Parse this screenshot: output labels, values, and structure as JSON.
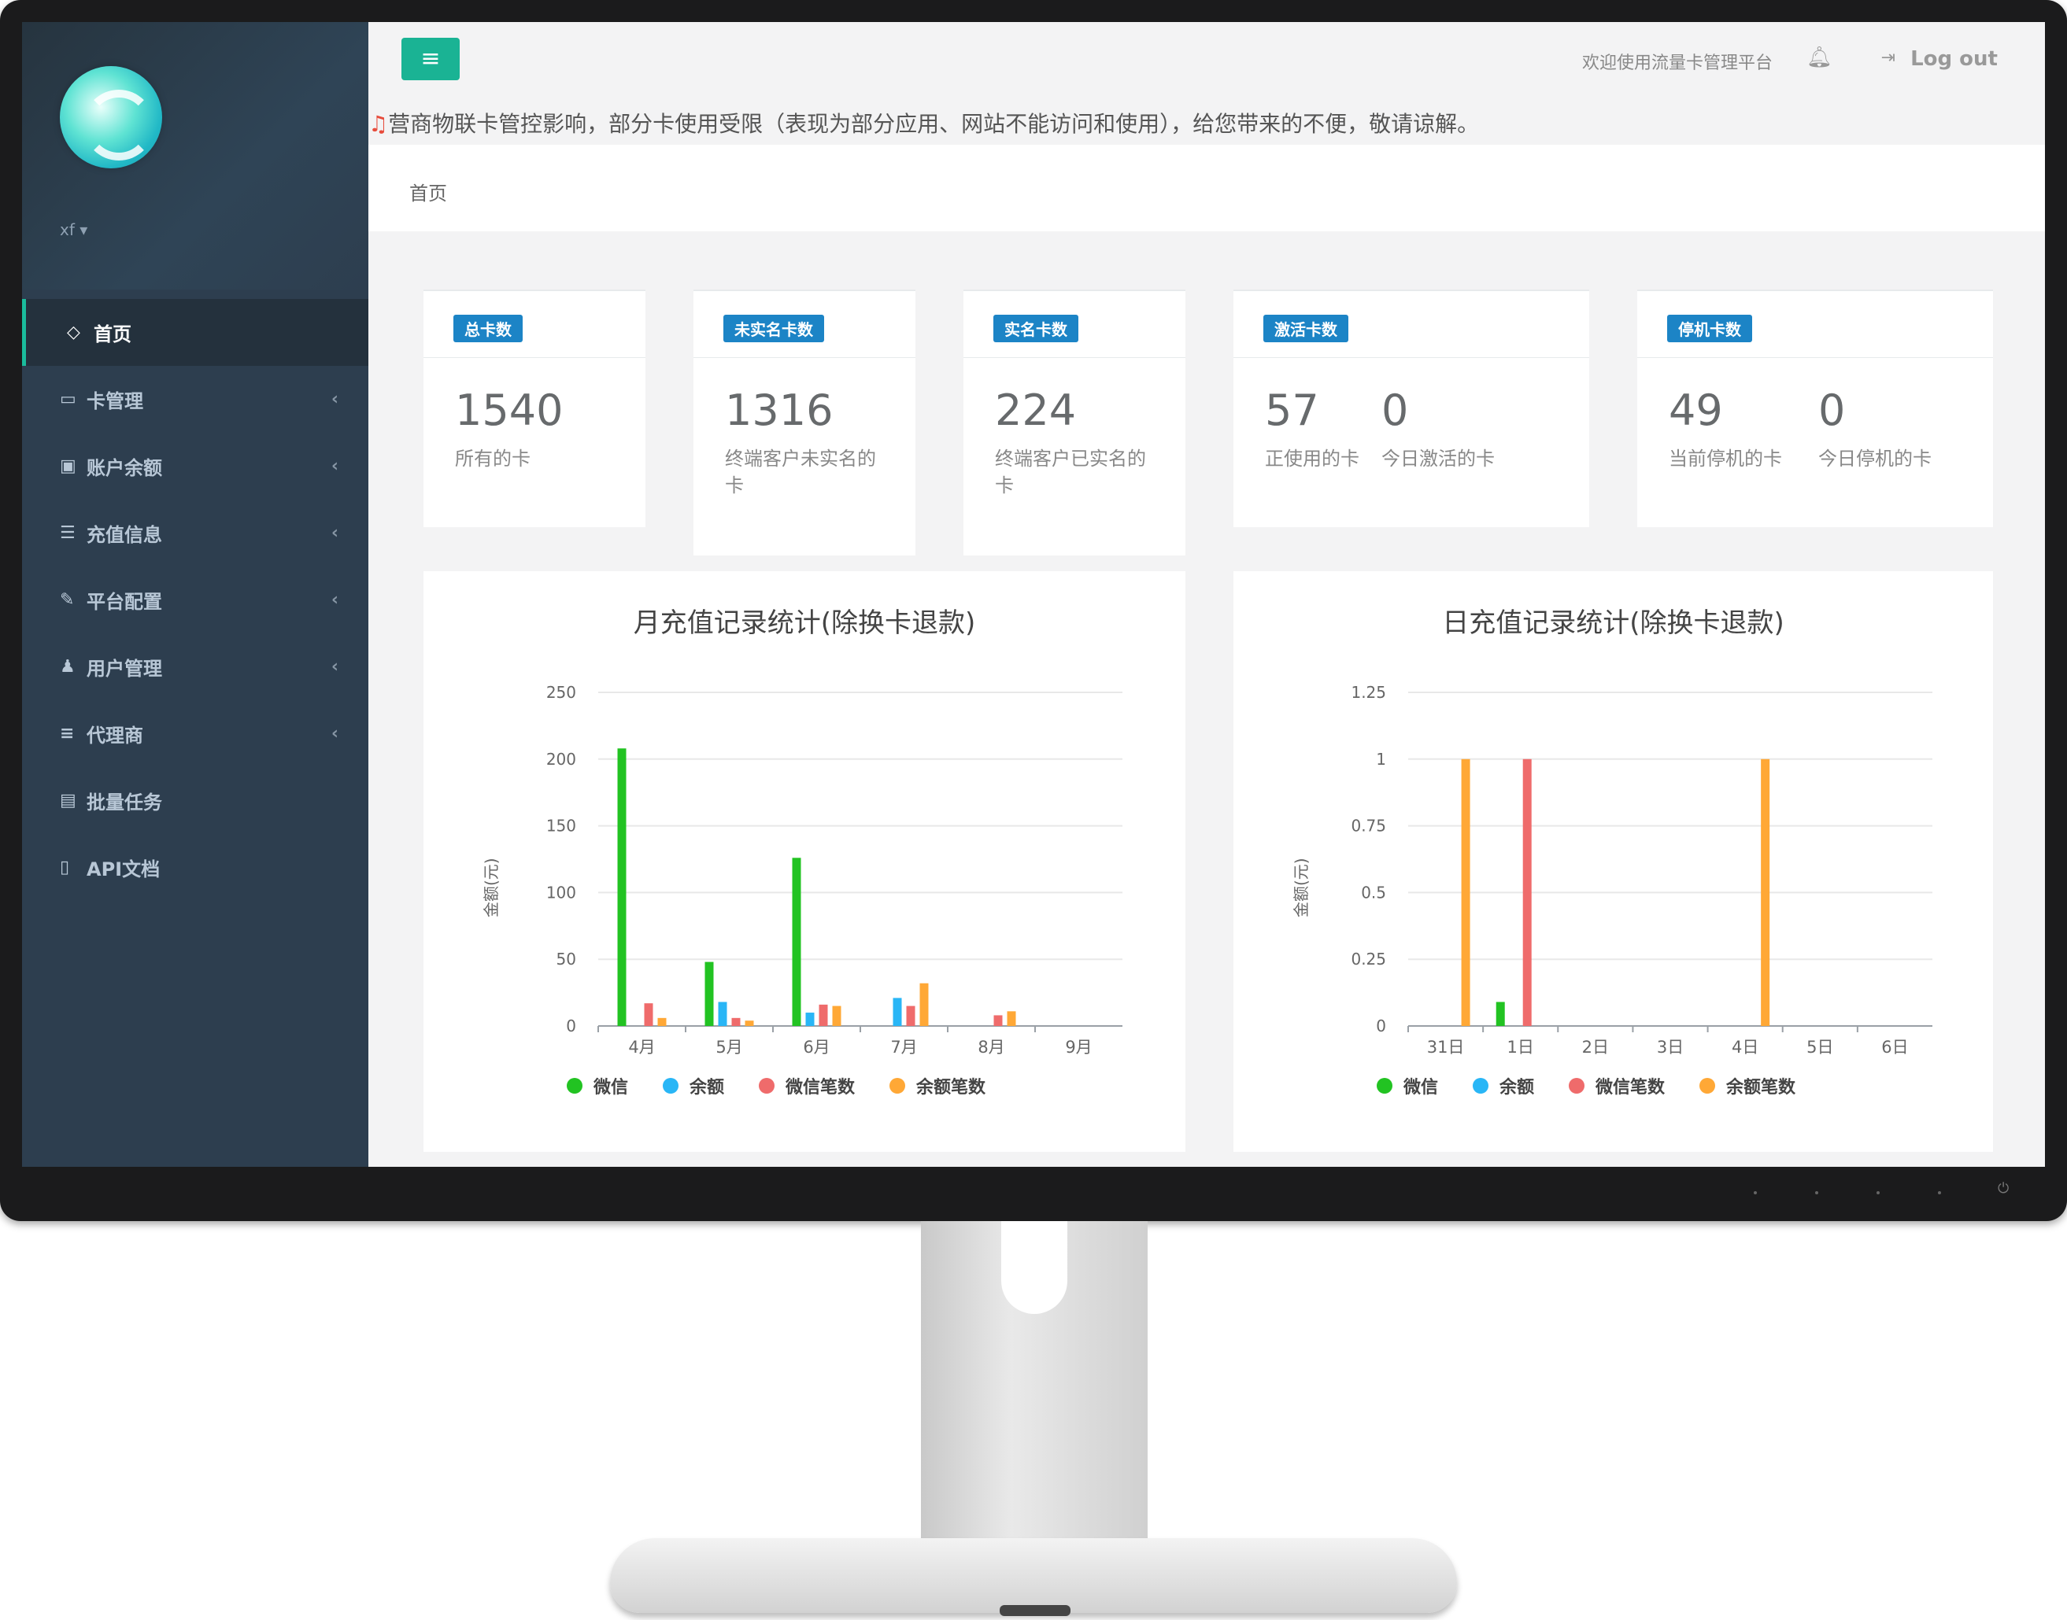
{
  "sidebar": {
    "user": "xf",
    "items": [
      {
        "label": "首页",
        "icon": "gem-icon"
      },
      {
        "label": "卡管理",
        "icon": "credit-card-icon"
      },
      {
        "label": "账户余额",
        "icon": "money-icon"
      },
      {
        "label": "充值信息",
        "icon": "list-icon"
      },
      {
        "label": "平台配置",
        "icon": "wrench-icon"
      },
      {
        "label": "用户管理",
        "icon": "users-icon"
      },
      {
        "label": "代理商",
        "icon": "bars-icon"
      },
      {
        "label": "批量任务",
        "icon": "tasks-icon"
      },
      {
        "label": "API文档",
        "icon": "file-icon"
      }
    ]
  },
  "header": {
    "welcome": "欢迎使用流量卡管理平台",
    "logout": "Log out",
    "notice": "营商物联卡管控影响，部分卡使用受限（表现为部分应用、网站不能访问和使用），给您带来的不便，敬请谅解。",
    "breadcrumb": "首页"
  },
  "stats": {
    "total": {
      "badge": "总卡数",
      "value": "1540",
      "label": "所有的卡"
    },
    "unverified": {
      "badge": "未实名卡数",
      "value": "1316",
      "label": "终端客户未实名的卡"
    },
    "verified": {
      "badge": "实名卡数",
      "value": "224",
      "label": "终端客户已实名的卡"
    },
    "active": {
      "badge": "激活卡数",
      "value1": "57",
      "label1": "正使用的卡",
      "value2": "0",
      "label2": "今日激活的卡"
    },
    "stopped": {
      "badge": "停机卡数",
      "value1": "49",
      "label1": "当前停机的卡",
      "value2": "0",
      "label2": "今日停机的卡"
    }
  },
  "colors": {
    "green": "#22c322",
    "blue": "#29b6f6",
    "red": "#ef6b6b",
    "orange": "#ffa836",
    "accent": "#1ab394",
    "badge": "#1c84c6"
  },
  "chart_data": [
    {
      "type": "bar",
      "title": "月充值记录统计(除换卡退款)",
      "ylabel": "金额(元)",
      "ylim": [
        0,
        250
      ],
      "yticks": [
        "0",
        "50",
        "100",
        "150",
        "200",
        "250"
      ],
      "categories": [
        "4月",
        "5月",
        "6月",
        "7月",
        "8月",
        "9月"
      ],
      "series": [
        {
          "name": "微信",
          "values": [
            208,
            48,
            126,
            0,
            0,
            0
          ]
        },
        {
          "name": "余额",
          "values": [
            0,
            18,
            10,
            21,
            0,
            0
          ]
        },
        {
          "name": "微信笔数",
          "values": [
            17,
            6,
            16,
            15,
            8,
            0
          ]
        },
        {
          "name": "余额笔数",
          "values": [
            6,
            4,
            15,
            32,
            11,
            0
          ]
        }
      ]
    },
    {
      "type": "bar",
      "title": "日充值记录统计(除换卡退款)",
      "ylabel": "金额(元)",
      "ylim": [
        0,
        1.25
      ],
      "yticks": [
        "0",
        "0.25",
        "0.5",
        "0.75",
        "1",
        "1.25"
      ],
      "categories": [
        "31日",
        "1日",
        "2日",
        "3日",
        "4日",
        "5日",
        "6日"
      ],
      "series": [
        {
          "name": "微信",
          "values": [
            0,
            0.09,
            0,
            0,
            0,
            0,
            0
          ]
        },
        {
          "name": "余额",
          "values": [
            0,
            0,
            0,
            0,
            0,
            0,
            0
          ]
        },
        {
          "name": "微信笔数",
          "values": [
            0,
            1,
            0,
            0,
            0,
            0,
            0
          ]
        },
        {
          "name": "余额笔数",
          "values": [
            1,
            0,
            0,
            0,
            1,
            0,
            0
          ]
        }
      ]
    }
  ]
}
